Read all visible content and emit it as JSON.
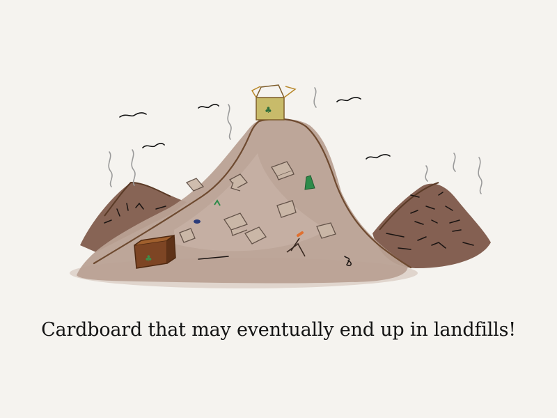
{
  "caption": "Cardboard that may eventually end up in landfills!",
  "illustration": {
    "subject": "landfill-mound",
    "colors": {
      "background": "#f5f3ef",
      "mound_main": "#b9a193",
      "mound_shadow": "#a88c7c",
      "side_mound": "#7d5848",
      "outline": "#6e4a30",
      "box_top": "#c8bb6a",
      "box_brown": "#7d4524",
      "bottle": "#2e8b4a"
    }
  }
}
